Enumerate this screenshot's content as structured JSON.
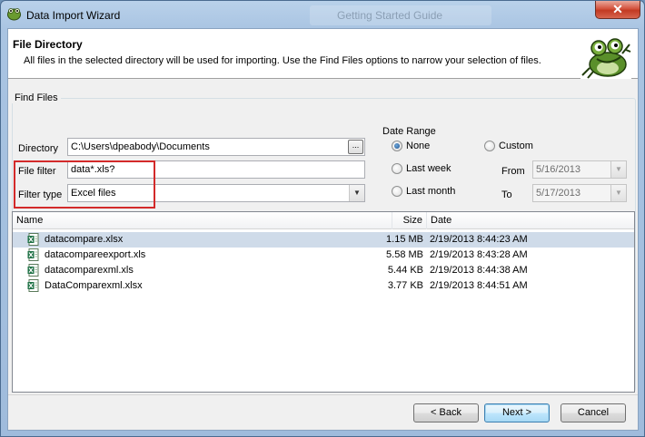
{
  "window": {
    "title": "Data Import Wizard",
    "background_hint": "Getting Started Guide"
  },
  "header": {
    "title": "File Directory",
    "description": "All files in the selected directory will be used for importing.  Use the Find Files options to narrow your selection of files."
  },
  "find_files": {
    "group_label": "Find Files",
    "directory": {
      "label": "Directory",
      "value": "C:\\Users\\dpeabody\\Documents",
      "browse_label": "..."
    },
    "file_filter": {
      "label": "File filter",
      "value": "data*.xls?"
    },
    "filter_type": {
      "label": "Filter type",
      "value": "Excel files"
    },
    "date_range": {
      "label": "Date Range",
      "options": {
        "none": "None",
        "custom": "Custom",
        "last_week": "Last week",
        "last_month": "Last month"
      },
      "selected": "None",
      "from": {
        "label": "From",
        "value": "5/16/2013"
      },
      "to": {
        "label": "To",
        "value": "5/17/2013"
      }
    }
  },
  "file_list": {
    "columns": {
      "name": "Name",
      "size": "Size",
      "date": "Date"
    },
    "rows": [
      {
        "name": "datacompare.xlsx",
        "size": "1.15 MB",
        "date": "2/19/2013 8:44:23 AM",
        "selected": true
      },
      {
        "name": "datacompareexport.xls",
        "size": "5.58 MB",
        "date": "2/19/2013 8:43:28 AM",
        "selected": false
      },
      {
        "name": "datacomparexml.xls",
        "size": "5.44 KB",
        "date": "2/19/2013 8:44:38 AM",
        "selected": false
      },
      {
        "name": "DataComparexml.xlsx",
        "size": "3.77 KB",
        "date": "2/19/2013 8:44:51 AM",
        "selected": false
      }
    ]
  },
  "buttons": {
    "back": "< Back",
    "next": "Next >",
    "cancel": "Cancel"
  },
  "colors": {
    "highlight_box": "#d32a2a",
    "selected_row": "#cfdbe9",
    "excel_green": "#1e7145"
  }
}
